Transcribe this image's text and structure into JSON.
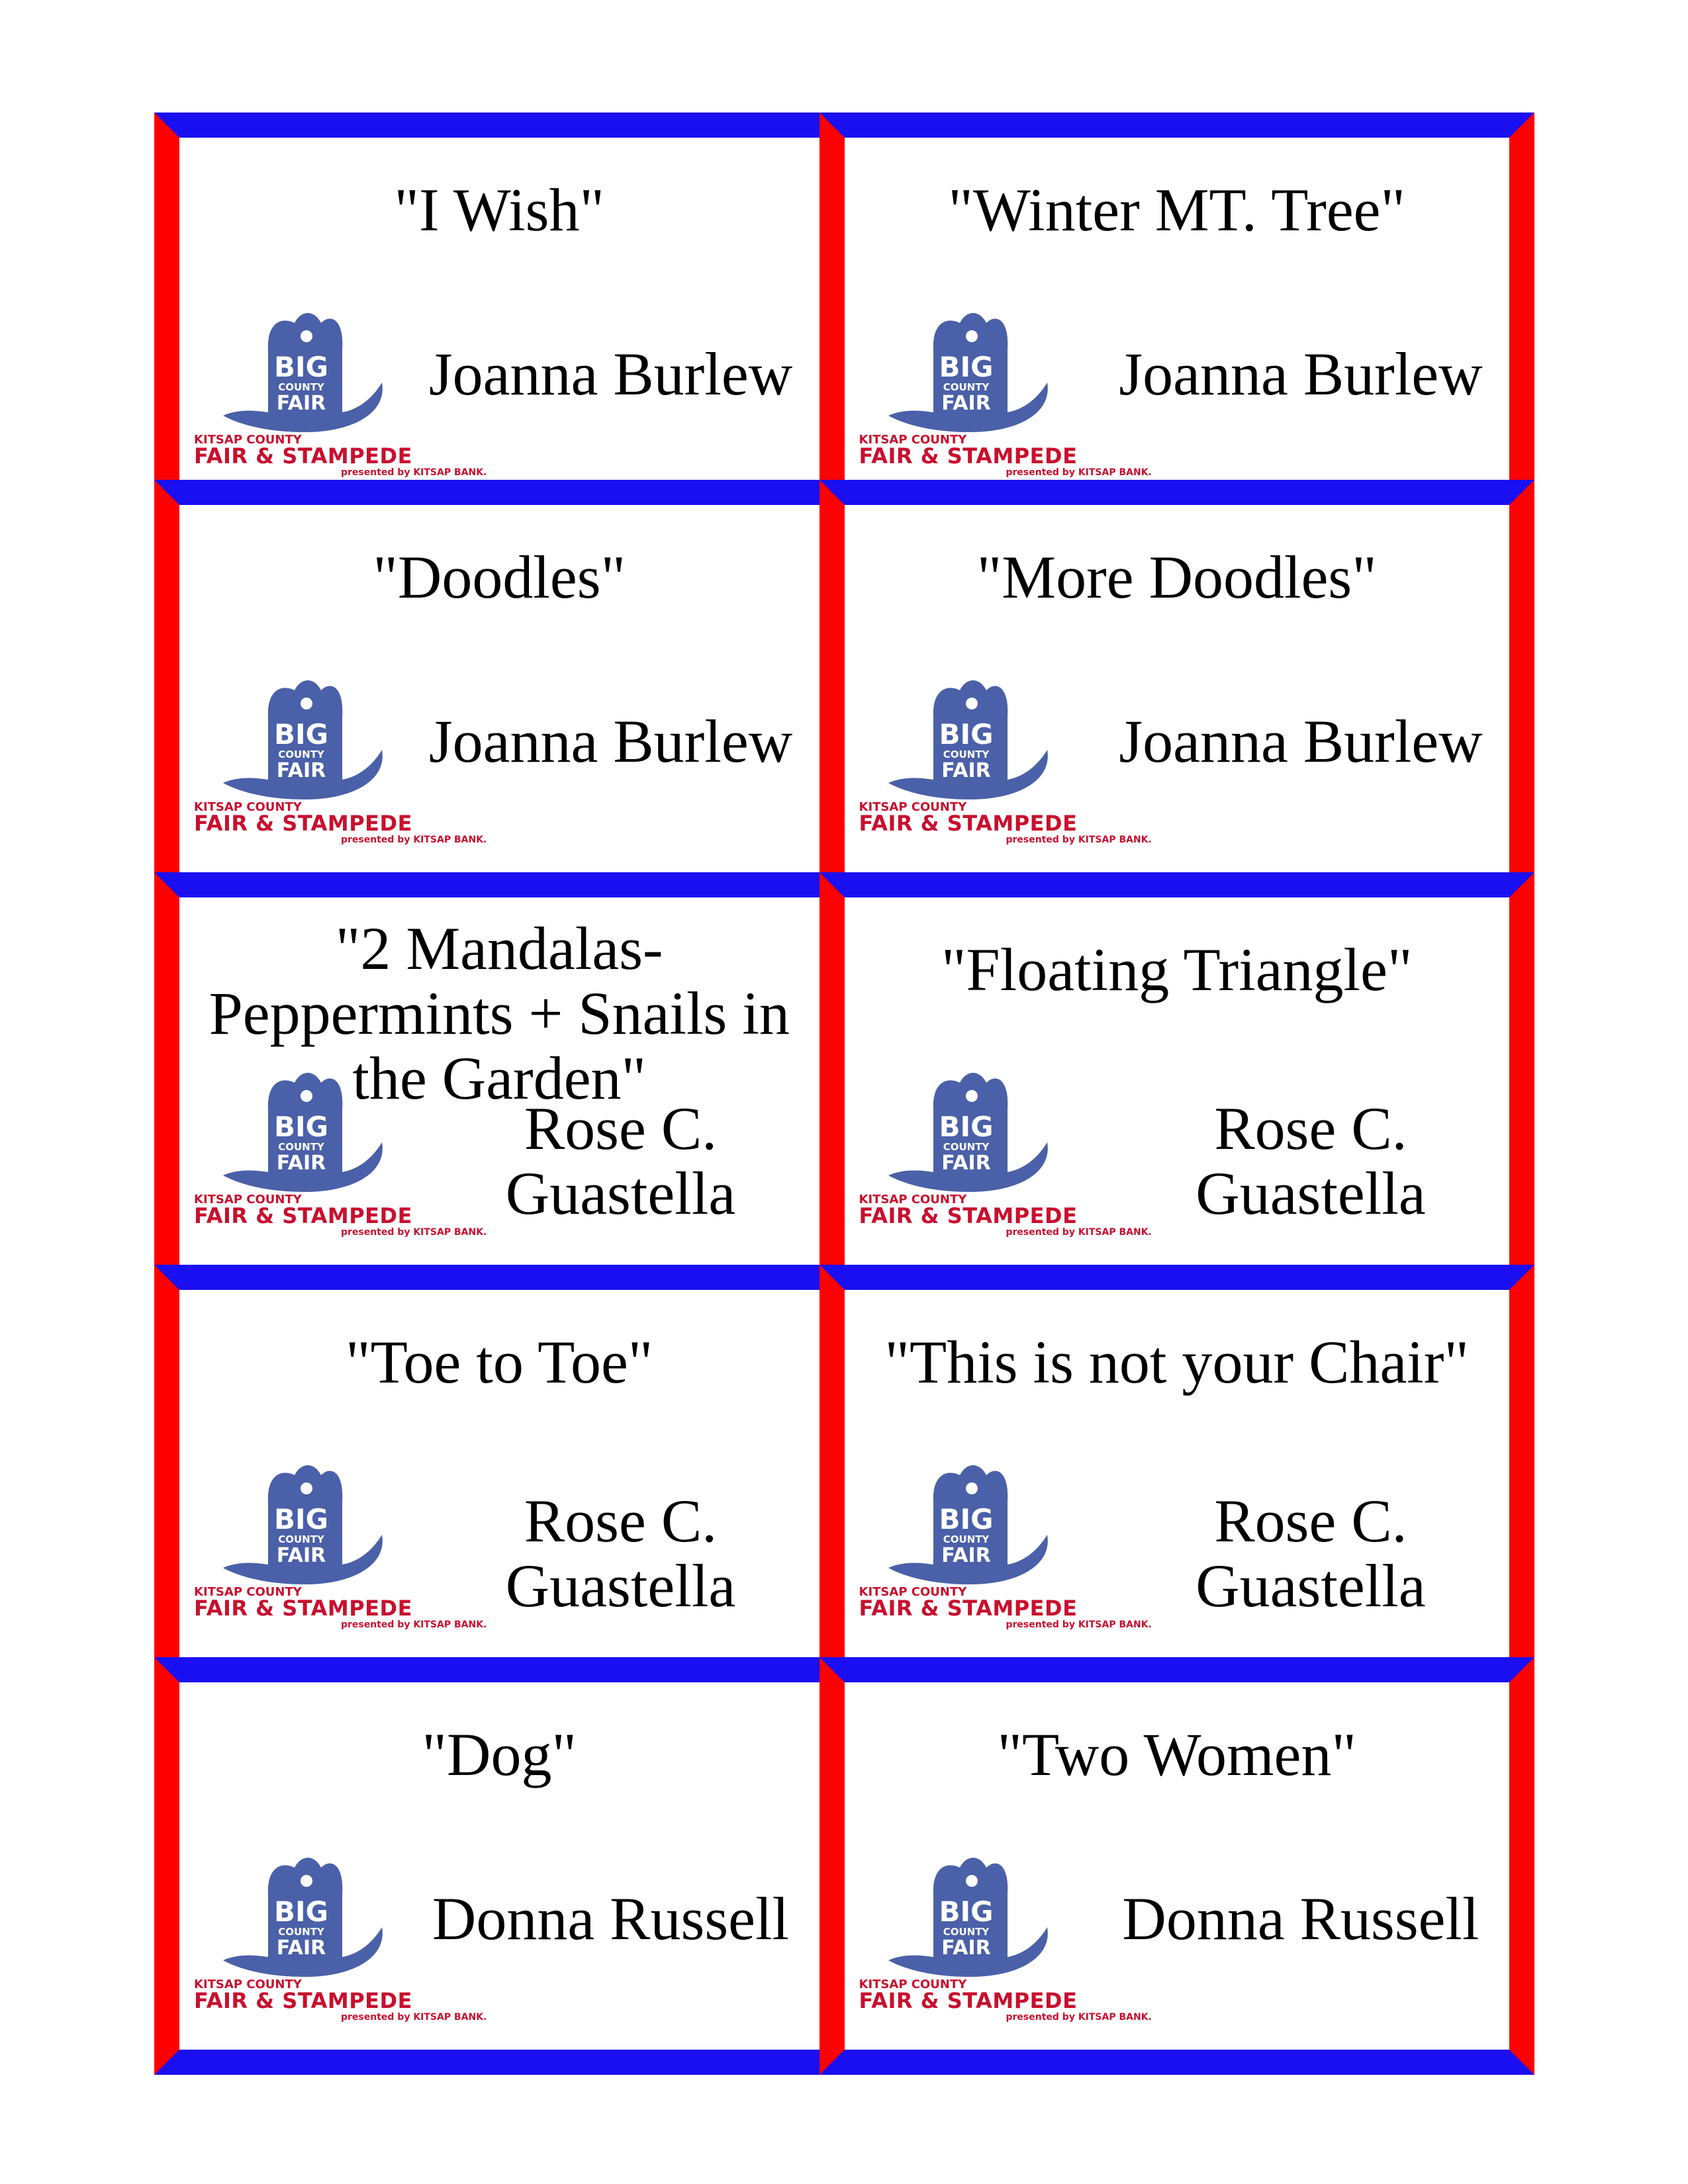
{
  "logo": {
    "big": "BIG",
    "county": "COUNTY",
    "fair": "FAIR",
    "line1": "KITSAP COUNTY",
    "line2": "FAIR & STAMPEDE",
    "line3": "presented by KITSAP BANK."
  },
  "colors": {
    "border_horizontal": "#1a0ff0",
    "border_vertical": "#ff0000",
    "logo_blue": "#4a60a8",
    "logo_red": "#c8102e"
  },
  "cards": [
    {
      "title": "\"I Wish\"",
      "artist": "Joanna Burlew"
    },
    {
      "title": "\"Winter MT. Tree\"",
      "artist": "Joanna Burlew"
    },
    {
      "title": "\"Doodles\"",
      "artist": "Joanna Burlew"
    },
    {
      "title": "\"More Doodles\"",
      "artist": "Joanna Burlew"
    },
    {
      "title": "\"2 Mandalas- Peppermints + Snails in the Garden\"",
      "artist": "Rose C. Guastella"
    },
    {
      "title": "\"Floating Triangle\"",
      "artist": "Rose C. Guastella"
    },
    {
      "title": "\"Toe to Toe\"",
      "artist": "Rose C. Guastella"
    },
    {
      "title": "\"This is not your Chair\"",
      "artist": "Rose C. Guastella"
    },
    {
      "title": "\"Dog\"",
      "artist": "Donna Russell"
    },
    {
      "title": "\"Two Women\"",
      "artist": "Donna Russell"
    }
  ]
}
